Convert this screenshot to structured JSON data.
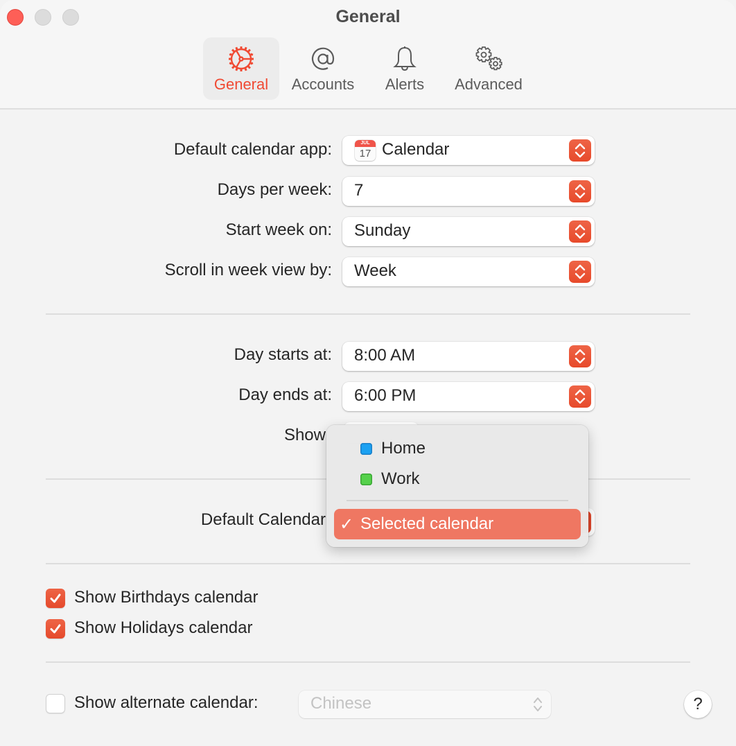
{
  "window": {
    "title": "General"
  },
  "toolbar": {
    "tabs": [
      {
        "id": "general",
        "label": "General",
        "icon": "gear-wheel-icon",
        "active": true
      },
      {
        "id": "accounts",
        "label": "Accounts",
        "icon": "at-sign-icon",
        "active": false
      },
      {
        "id": "alerts",
        "label": "Alerts",
        "icon": "bell-icon",
        "active": false
      },
      {
        "id": "advanced",
        "label": "Advanced",
        "icon": "gears-icon",
        "active": false
      }
    ]
  },
  "settings": {
    "default_calendar_app": {
      "label": "Default calendar app:",
      "value": "Calendar",
      "icon_month": "JUL",
      "icon_day": "17"
    },
    "days_per_week": {
      "label": "Days per week:",
      "value": "7"
    },
    "start_week_on": {
      "label": "Start week on:",
      "value": "Sunday"
    },
    "scroll_week_view": {
      "label": "Scroll in week view by:",
      "value": "Week"
    },
    "day_starts_at": {
      "label": "Day starts at:",
      "value": "8:00 AM"
    },
    "day_ends_at": {
      "label": "Day ends at:",
      "value": "6:00 PM"
    },
    "show": {
      "label": "Show"
    },
    "default_calendar": {
      "label": "Default Calendar"
    }
  },
  "dropdown_menu": {
    "items": [
      {
        "label": "Home",
        "color": "#1ba1f2",
        "border": "#1a7fc8"
      },
      {
        "label": "Work",
        "color": "#55d14b",
        "border": "#3aa734"
      }
    ],
    "selected": {
      "label": "Selected calendar",
      "check": "✓"
    }
  },
  "checkboxes": {
    "birthdays": {
      "label": "Show Birthdays calendar",
      "checked": true
    },
    "holidays": {
      "label": "Show Holidays calendar",
      "checked": true
    },
    "alternate": {
      "label": "Show alternate calendar:",
      "checked": false,
      "value": "Chinese"
    }
  },
  "help": {
    "label": "?"
  },
  "colors": {
    "accent": "#e94f2f",
    "menu_selection": "#ef7762"
  }
}
